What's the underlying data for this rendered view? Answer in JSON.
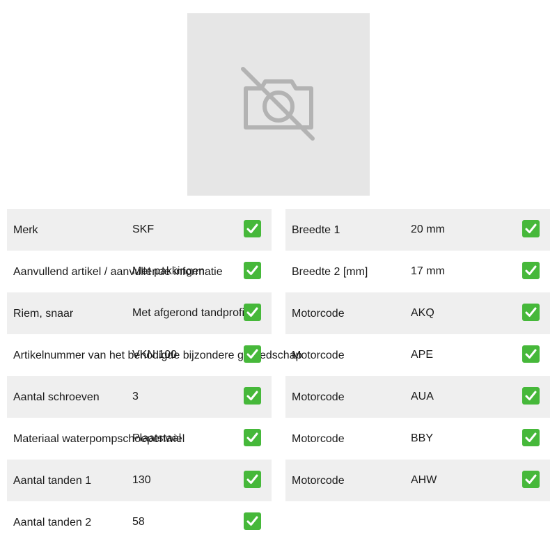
{
  "product_image": {
    "icon": "no-photo-camera-icon"
  },
  "specs_left": [
    {
      "label": "Merk",
      "value": "SKF"
    },
    {
      "label": "Aanvullend artikel / aanvullende informatie",
      "value": "Met pakkingen"
    },
    {
      "label": "Riem, snaar",
      "value": "Met afgerond tandprofiel"
    },
    {
      "label": "Artikelnummer van het benodigde bijzondere gereedschap",
      "value": "VKN 100"
    },
    {
      "label": "Aantal schroeven",
      "value": "3"
    },
    {
      "label": "Materiaal waterpompschoepenwiel",
      "value": "Plaatstaal"
    },
    {
      "label": "Aantal tanden 1",
      "value": "130"
    },
    {
      "label": "Aantal tanden 2",
      "value": "58"
    }
  ],
  "specs_right": [
    {
      "label": "Breedte 1",
      "value": "20 mm"
    },
    {
      "label": "Breedte 2 [mm]",
      "value": "17 mm"
    },
    {
      "label": "Motorcode",
      "value": "AKQ"
    },
    {
      "label": "Motorcode",
      "value": "APE"
    },
    {
      "label": "Motorcode",
      "value": "AUA"
    },
    {
      "label": "Motorcode",
      "value": "BBY"
    },
    {
      "label": "Motorcode",
      "value": "AHW"
    }
  ],
  "check_icon": "check-mark-icon",
  "colors": {
    "row_shade": "#efefef",
    "image_placeholder": "#e6e6e6",
    "icon_gray": "#b3b3b3",
    "check_green": "#46b83a"
  }
}
